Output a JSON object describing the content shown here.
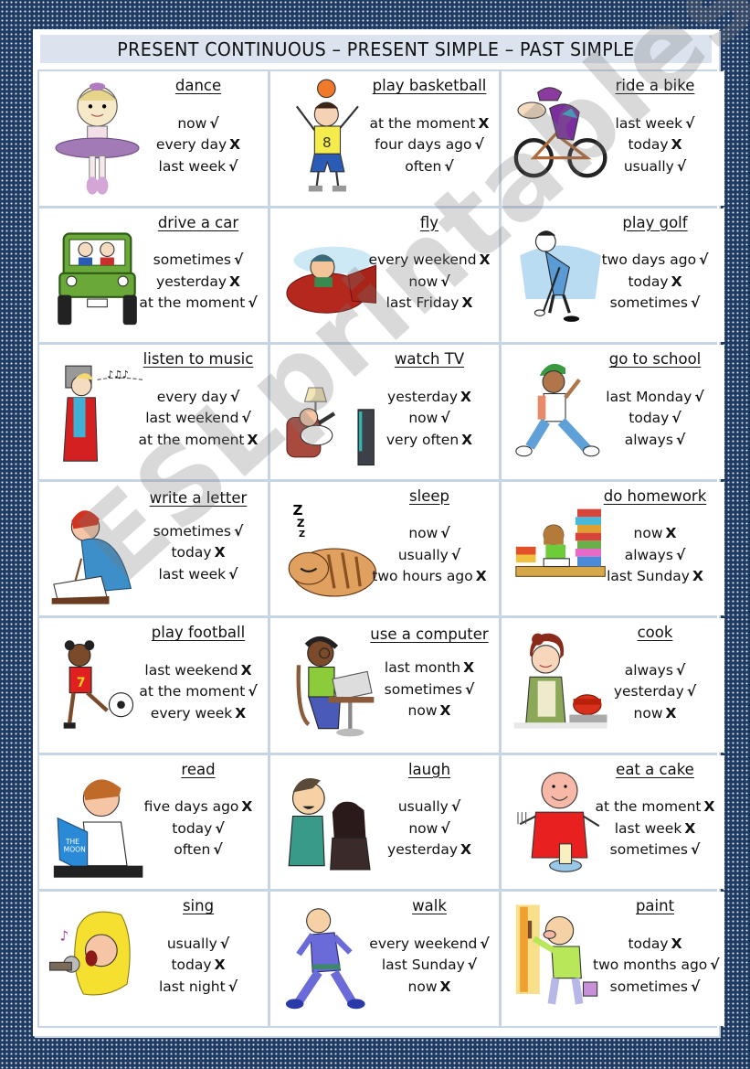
{
  "title": "PRESENT CONTINUOUS – PRESENT SIMPLE – PAST SIMPLE",
  "watermark": "ESLprintables.com",
  "marks": {
    "correct": "√",
    "wrong": "X"
  },
  "cards": [
    {
      "verb": "dance",
      "picture": "ballerina-icon",
      "items": [
        {
          "text": "now",
          "mark": "√"
        },
        {
          "text": "every day",
          "mark": "X"
        },
        {
          "text": "last week",
          "mark": "√"
        }
      ]
    },
    {
      "verb": "play basketball",
      "picture": "basketball-player-icon",
      "items": [
        {
          "text": "at the moment",
          "mark": "X"
        },
        {
          "text": "four days ago",
          "mark": "√"
        },
        {
          "text": "often",
          "mark": "√"
        }
      ]
    },
    {
      "verb": "ride a bike",
      "picture": "cyclist-icon",
      "items": [
        {
          "text": "last week",
          "mark": "√"
        },
        {
          "text": "today",
          "mark": "X"
        },
        {
          "text": "usually",
          "mark": "√"
        }
      ]
    },
    {
      "verb": "drive a car",
      "picture": "car-icon",
      "items": [
        {
          "text": "sometimes",
          "mark": "√"
        },
        {
          "text": "yesterday",
          "mark": "X"
        },
        {
          "text": "at the moment",
          "mark": "√"
        }
      ]
    },
    {
      "verb": "fly",
      "picture": "airplane-icon",
      "items": [
        {
          "text": "every weekend",
          "mark": "X"
        },
        {
          "text": "now",
          "mark": "√"
        },
        {
          "text": "last Friday",
          "mark": "X"
        }
      ]
    },
    {
      "verb": "play golf",
      "picture": "golfer-icon",
      "items": [
        {
          "text": "two days ago",
          "mark": "√"
        },
        {
          "text": "today",
          "mark": "X"
        },
        {
          "text": "sometimes",
          "mark": "√"
        }
      ]
    },
    {
      "verb": "listen to music",
      "picture": "radio-listener-icon",
      "items": [
        {
          "text": "every day",
          "mark": "√"
        },
        {
          "text": "last weekend",
          "mark": "√"
        },
        {
          "text": "at the moment",
          "mark": "X"
        }
      ]
    },
    {
      "verb": "watch TV",
      "picture": "tv-watcher-icon",
      "items": [
        {
          "text": "yesterday",
          "mark": "X"
        },
        {
          "text": "now",
          "mark": "√"
        },
        {
          "text": "very often",
          "mark": "X"
        }
      ]
    },
    {
      "verb": "go to school",
      "picture": "schoolboy-icon",
      "items": [
        {
          "text": "last Monday",
          "mark": "√"
        },
        {
          "text": "today",
          "mark": "√"
        },
        {
          "text": "always",
          "mark": "√"
        }
      ]
    },
    {
      "verb": "write a letter",
      "picture": "writer-icon",
      "items": [
        {
          "text": "sometimes",
          "mark": "√"
        },
        {
          "text": "today",
          "mark": "X"
        },
        {
          "text": "last week",
          "mark": "√"
        }
      ]
    },
    {
      "verb": "sleep",
      "picture": "sleeping-cat-icon",
      "items": [
        {
          "text": "now",
          "mark": "√"
        },
        {
          "text": "usually",
          "mark": "√"
        },
        {
          "text": "two hours ago",
          "mark": "X"
        }
      ]
    },
    {
      "verb": "do homework",
      "picture": "homework-icon",
      "items": [
        {
          "text": "now",
          "mark": "X"
        },
        {
          "text": "always",
          "mark": "√"
        },
        {
          "text": "last Sunday",
          "mark": "X"
        }
      ]
    },
    {
      "verb": "play football",
      "picture": "football-player-icon",
      "items": [
        {
          "text": "last weekend",
          "mark": "X"
        },
        {
          "text": "at the moment",
          "mark": "√"
        },
        {
          "text": "every week",
          "mark": "X"
        }
      ]
    },
    {
      "verb": "use a computer",
      "picture": "computer-user-icon",
      "items": [
        {
          "text": "last month",
          "mark": "X"
        },
        {
          "text": "sometimes",
          "mark": "√"
        },
        {
          "text": "now",
          "mark": "X"
        }
      ]
    },
    {
      "verb": "cook",
      "picture": "cook-icon",
      "items": [
        {
          "text": "always",
          "mark": "√"
        },
        {
          "text": "yesterday",
          "mark": "√"
        },
        {
          "text": "now",
          "mark": "X"
        }
      ]
    },
    {
      "verb": "read",
      "picture": "reader-icon",
      "items": [
        {
          "text": "five days ago",
          "mark": "X"
        },
        {
          "text": "today",
          "mark": "√"
        },
        {
          "text": "often",
          "mark": "√"
        }
      ]
    },
    {
      "verb": "laugh",
      "picture": "laughing-girls-icon",
      "items": [
        {
          "text": "usually",
          "mark": "√"
        },
        {
          "text": "now",
          "mark": "√"
        },
        {
          "text": "yesterday",
          "mark": "X"
        }
      ]
    },
    {
      "verb": "eat a cake",
      "picture": "cake-eater-icon",
      "items": [
        {
          "text": "at the moment",
          "mark": "X"
        },
        {
          "text": "last week",
          "mark": "X"
        },
        {
          "text": "sometimes",
          "mark": "√"
        }
      ]
    },
    {
      "verb": "sing",
      "picture": "singer-icon",
      "items": [
        {
          "text": "usually",
          "mark": "√"
        },
        {
          "text": "today",
          "mark": "X"
        },
        {
          "text": "last night",
          "mark": "√"
        }
      ]
    },
    {
      "verb": "walk",
      "picture": "walking-man-icon",
      "items": [
        {
          "text": "every weekend",
          "mark": "√"
        },
        {
          "text": "last Sunday",
          "mark": "√"
        },
        {
          "text": "now",
          "mark": "X"
        }
      ]
    },
    {
      "verb": "paint",
      "picture": "painter-icon",
      "items": [
        {
          "text": "today",
          "mark": "X"
        },
        {
          "text": "two months ago",
          "mark": "√"
        },
        {
          "text": "sometimes",
          "mark": "√"
        }
      ]
    }
  ]
}
